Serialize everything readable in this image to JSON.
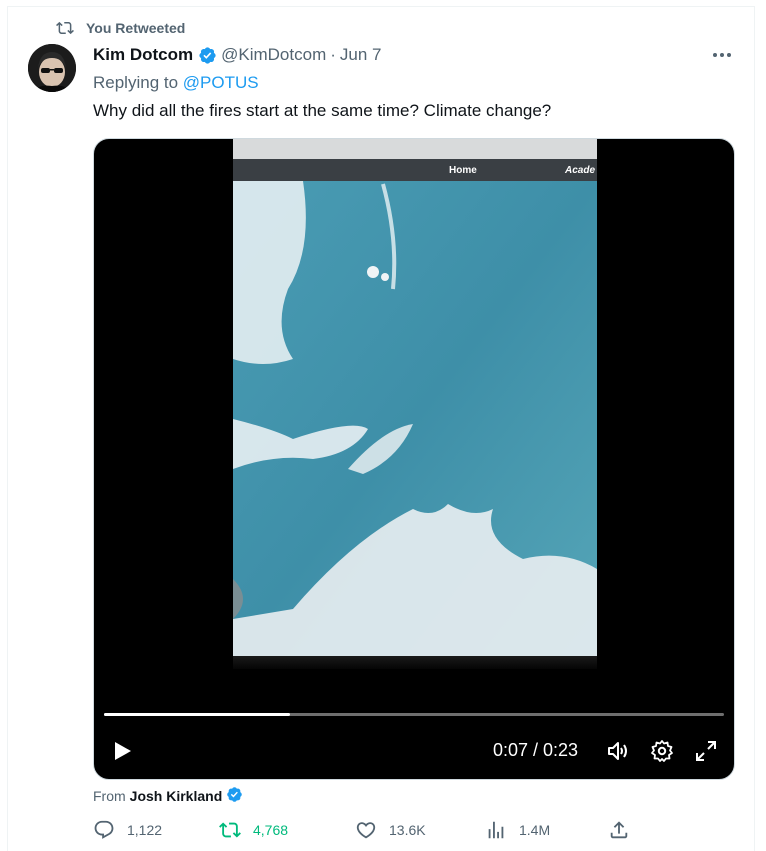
{
  "retweet_label": "You Retweeted",
  "author": {
    "name": "Kim Dotcom",
    "handle": "@KimDotcom",
    "separator": "·",
    "date": "Jun 7"
  },
  "reply": {
    "prefix": "Replying to",
    "mention": "@POTUS"
  },
  "text": "Why did all the fires start at the same time? Climate change?",
  "video": {
    "frame_labels": [
      "Home",
      "Acade"
    ],
    "current_time": "0:07",
    "duration": "0:23",
    "time_display": "0:07 / 0:23",
    "progress": 0.3
  },
  "source": {
    "prefix": "From",
    "name": "Josh Kirkland"
  },
  "actions": {
    "replies": "1,122",
    "retweets": "4,768",
    "likes": "13.6K",
    "views": "1.4M"
  },
  "colors": {
    "accent": "#1d9bf0",
    "retweet_green": "#00ba7c",
    "muted": "#536471"
  },
  "icons": [
    "retweet-icon",
    "verified-badge-icon",
    "more-icon",
    "play-icon",
    "volume-icon",
    "settings-icon",
    "fullscreen-icon",
    "reply-icon",
    "like-icon",
    "views-icon",
    "share-icon"
  ]
}
